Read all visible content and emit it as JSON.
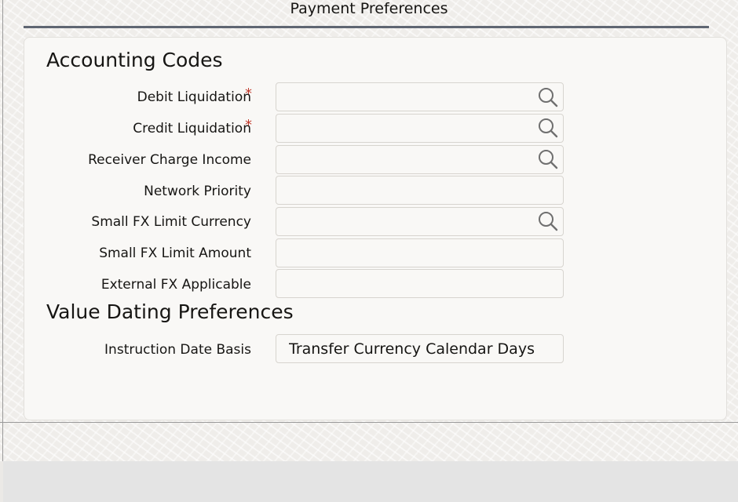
{
  "header": {
    "title": "Payment Preferences"
  },
  "accounting_codes": {
    "heading": "Accounting Codes",
    "fields": [
      {
        "label": "Debit Liquidation",
        "required": "*",
        "value": ""
      },
      {
        "label": "Credit Liquidation",
        "required": "*",
        "value": ""
      },
      {
        "label": "Receiver Charge Income",
        "value": ""
      },
      {
        "label": "Network Priority",
        "value": ""
      },
      {
        "label": "Small FX Limit Currency",
        "value": ""
      },
      {
        "label": "Small FX Limit Amount",
        "value": ""
      },
      {
        "label": "External FX Applicable",
        "value": ""
      }
    ]
  },
  "value_dating": {
    "heading": "Value Dating Preferences",
    "fields": [
      {
        "label": "Instruction Date Basis",
        "value": "Transfer Currency Calendar Days"
      }
    ]
  },
  "icons": {
    "lookup": "search-icon"
  },
  "colors": {
    "required": "#c0392b",
    "title_rule": "#5f6672"
  }
}
